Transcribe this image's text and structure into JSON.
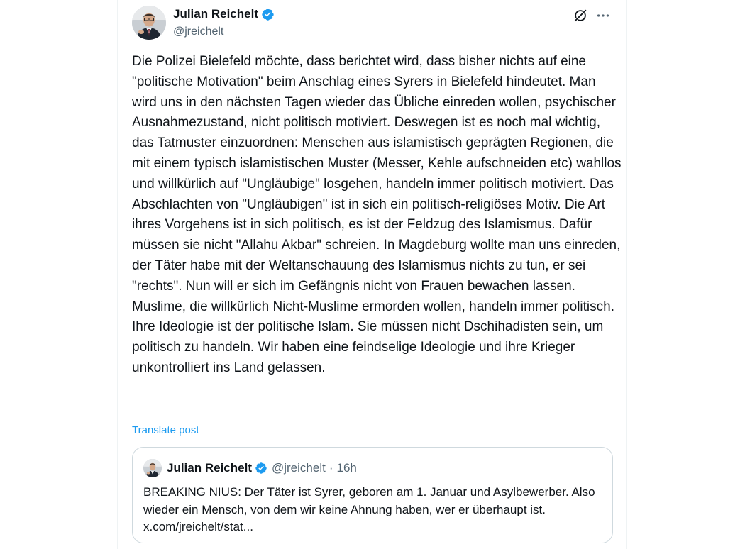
{
  "post": {
    "author": {
      "display_name": "Julian Reichelt",
      "handle": "@jreichelt",
      "verified": true,
      "avatar": "profile-photo"
    },
    "header_icons": [
      "grok-icon",
      "more-options-icon"
    ],
    "text": "Die Polizei Bielefeld möchte, dass berichtet wird, dass bisher nichts auf eine \"politische Motivation\" beim Anschlag eines Syrers in Bielefeld hindeutet. Man wird uns in den nächsten Tagen wieder das Übliche einreden wollen, psychischer Ausnahmezustand, nicht politisch motiviert. Deswegen ist es noch mal wichtig, das Tatmuster einzuordnen: Menschen aus islamistisch geprägten Regionen, die mit einem typisch islamistischen Muster (Messer, Kehle aufschneiden etc) wahllos und willkürlich auf \"Ungläubige\" losgehen, handeln immer politisch motiviert. Das Abschlachten von \"Ungläubigen\" ist in sich ein politisch-religiöses Motiv. Die Art ihres Vorgehens ist in sich politisch, es ist der Feldzug des Islamismus. Dafür müssen sie nicht \"Allahu Akbar\" schreien. In Magdeburg wollte man uns einreden, der Täter habe mit der Weltanschauung des Islamismus nichts zu tun, er sei \"rechts\". Nun will er sich im Gefängnis nicht von Frauen bewachen lassen. Muslime, die willkürlich Nicht-Muslime ermorden wollen, handeln immer politisch. Ihre Ideologie ist der politische Islam. Sie müssen nicht Dschihadisten sein, um politisch zu handeln. Wir haben eine feindselige Ideologie und ihre Krieger unkontrolliert ins Land gelassen.",
    "translate_label": "Translate post"
  },
  "quote": {
    "author": {
      "display_name": "Julian Reichelt",
      "handle": "@jreichelt",
      "verified": true
    },
    "separator": "·",
    "time": "16h",
    "text": "BREAKING NIUS: Der Täter ist Syrer, geboren am 1. Januar und Asylbewerber. Also wieder ein Mensch, von dem wir keine Ahnung haben, wer er überhaupt ist. x.com/jreichelt/stat..."
  },
  "colors": {
    "text_primary": "#0f1419",
    "text_secondary": "#536471",
    "accent_blue": "#1d9bf0",
    "border": "#cfd9de"
  }
}
